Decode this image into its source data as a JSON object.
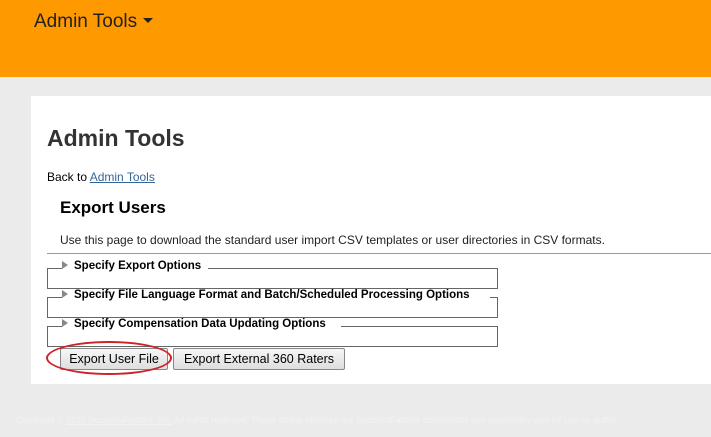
{
  "header": {
    "menu_label": "Admin Tools",
    "bar_color": "#ff9900"
  },
  "main": {
    "page_title": "Admin Tools",
    "back_prefix": "Back to ",
    "back_link": "Admin Tools",
    "section_title": "Export Users",
    "description": "Use this page to download the standard user import CSV templates or user directories in CSV formats.",
    "sections": [
      {
        "label": "Specify Export Options"
      },
      {
        "label": "Specify File Language Format and Batch/Scheduled Processing Options"
      },
      {
        "label": "Specify Compensation Data Updating Options"
      }
    ],
    "buttons": {
      "export_user_file": "Export User File",
      "export_raters": "Export External 360 Raters"
    },
    "highlight_color": "#d0202a"
  },
  "footer": {
    "prefix": "Copyright © ",
    "link": "2015 SuccessFactors, Inc.",
    "suffix": " All rights reserved. These online services are SuccessFactors confidential and proprietary and for use by autho"
  }
}
